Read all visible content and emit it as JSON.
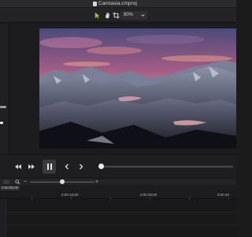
{
  "window": {
    "title": "Camtasia.cmproj"
  },
  "toolbar": {
    "zoom_value": "90%",
    "tools": [
      "select-tool",
      "hand-tool",
      "crop-tool"
    ]
  },
  "playback": {
    "buttons": [
      "step-back",
      "step-forward",
      "play",
      "previous-frame",
      "next-frame"
    ],
    "scrubber_progress": 0.0
  },
  "timeline": {
    "zoom_minus": "−",
    "zoom_plus": "+",
    "playhead_time": "0:00:00;00",
    "ruler_labels": [
      "0:00:15;00",
      "0:00:30;00",
      "0:00:45"
    ]
  },
  "colors": {
    "accent_green": "#8ecf3b",
    "background": "#1b1b1c"
  }
}
